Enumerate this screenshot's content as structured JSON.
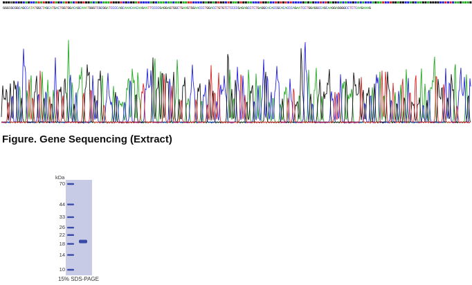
{
  "sequencing": {
    "bases": "GGGSGCGGCAGCCATATGGCTAGCATGACTGGTGGACAGCAAATGGGTCGCGGATCCCCAGCAAACAACAAGAATTCCCCGAGGAGTGGCTGAAGTGGAACCCTGGACCTGTGTCTCCCCGAGAGCCTCTGAGGCACACCGCACACCCAGAATCCTGGAGGCCAGCAAGGAGGGGCCTCTCAAGAAAG",
    "trace_colors": {
      "A": "#22aa22",
      "C": "#2222dd",
      "G": "#111111",
      "T": "#dd2222"
    },
    "caption": "Figure. Gene Sequencing (Extract)"
  },
  "gel": {
    "unit_label": "kDa",
    "markers": [
      "70",
      "44",
      "33",
      "26",
      "22",
      "18",
      "14",
      "10"
    ],
    "marker_kda": [
      70,
      44,
      33,
      26,
      22,
      18,
      14,
      10
    ],
    "sample_band_kda": 19,
    "caption": "15% SDS-PAGE",
    "gel_color": "#c8cbe6",
    "band_color": "#3a4aa8"
  }
}
